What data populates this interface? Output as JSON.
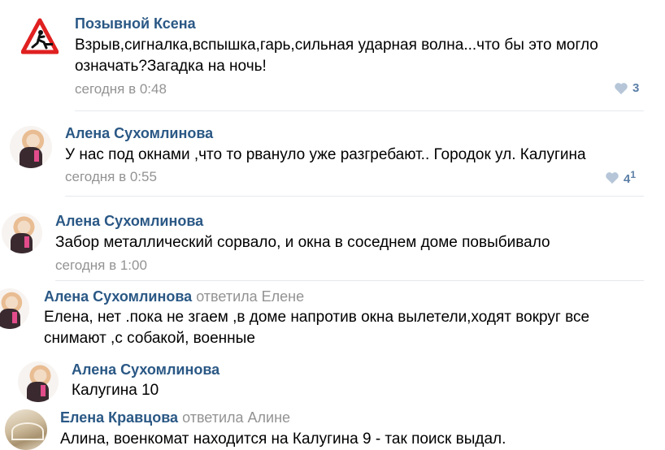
{
  "comments": [
    {
      "author": "Позывной Ксена",
      "text_lines": [
        "Взрыв,сигналка,вспышка,гарь,сильная ударная волна...что бы это могло",
        "означать?Загадка на ночь!"
      ],
      "date": "сегодня в 0:48",
      "likes": "3"
    },
    {
      "author": "Алена Сухомлинова",
      "text_lines": [
        "У нас под окнами ,что то рвануло уже разгребают.. Городок ул. Калугина"
      ],
      "date": "сегодня в 0:55",
      "likes": "4",
      "likes_sup": "1"
    },
    {
      "author": "Алена Сухомлинова",
      "text_lines": [
        "Забор металлический сорвало, и окна в соседнем доме повыбивало"
      ],
      "date": "сегодня в 1:00"
    },
    {
      "author": "Алена Сухомлинова",
      "reply_to": "ответила Елене",
      "text_lines": [
        "Елена, нет .пока не згаем ,в доме напротив окна вылетели,ходят вокруг все",
        "снимают ,с собакой, военные"
      ]
    },
    {
      "author": "Алена Сухомлинова",
      "text_lines": [
        "Калугина 10"
      ]
    },
    {
      "author": "Елена Кравцова",
      "reply_to": "ответила Алине",
      "text_lines": [
        "Алина, военкомат находится на Калугина 9 - так поиск выдал."
      ]
    }
  ],
  "icons": {
    "avatar_1": "warning-sign-icon",
    "like": "heart-icon"
  },
  "colors": {
    "author": "#2a5885",
    "meta": "#939393",
    "like": "#5b7fa6",
    "separator": "#e7e8ec",
    "warning_red": "#e02020"
  }
}
